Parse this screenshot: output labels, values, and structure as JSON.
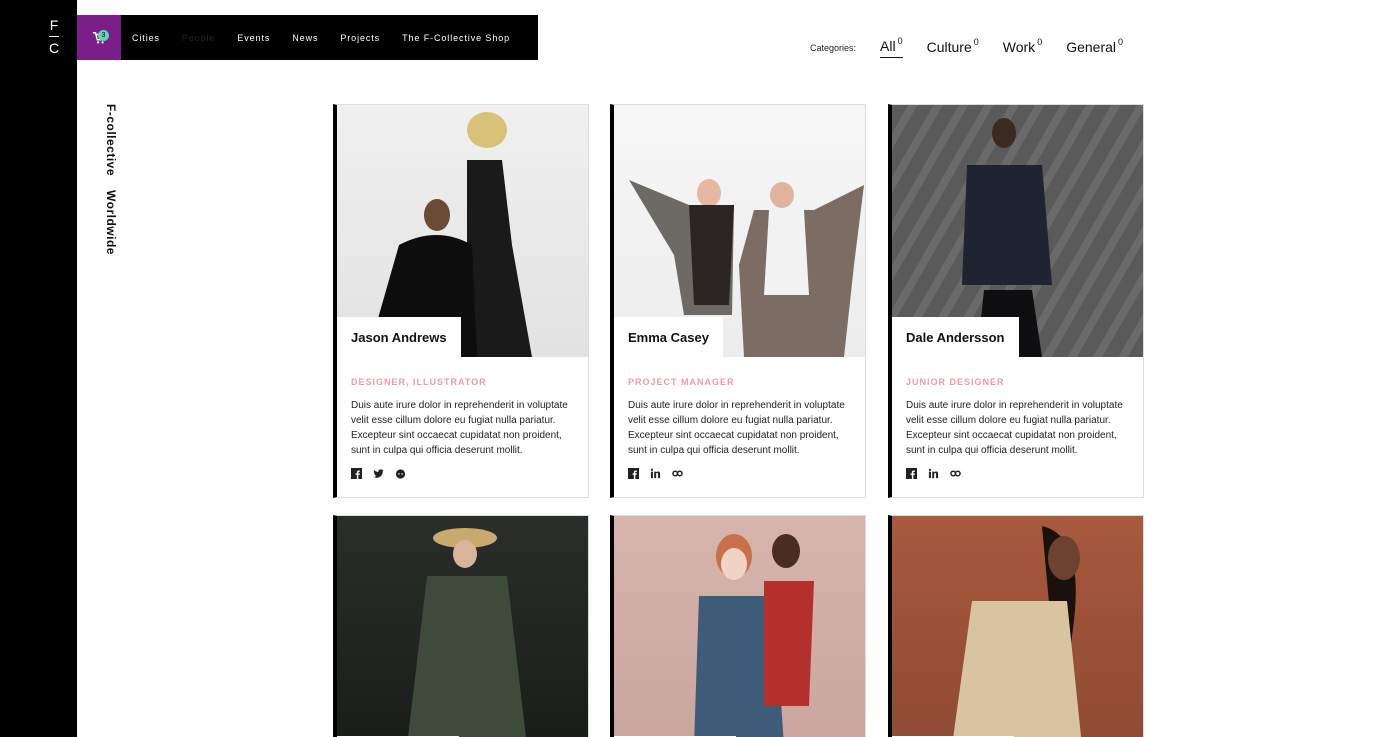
{
  "logo": {
    "line1": "F",
    "line2": "C"
  },
  "site_title": {
    "part1": "F-collective",
    "part2": "Worldwide"
  },
  "cart": {
    "count": "3"
  },
  "nav": [
    "Cities",
    "People",
    "Events",
    "News",
    "Projects",
    "The F-Collective Shop"
  ],
  "categories": {
    "label": "Categories:",
    "items": [
      {
        "label": "All",
        "count": "0"
      },
      {
        "label": "Culture",
        "count": "0"
      },
      {
        "label": "Work",
        "count": "0"
      },
      {
        "label": "General",
        "count": "0"
      }
    ]
  },
  "cards": [
    {
      "name": "Jason Andrews",
      "role": "Designer, Illustrator",
      "desc": "Duis aute irure dolor in reprehenderit in voluptate velit esse cillum dolore eu fugiat nulla pariatur. Excepteur sint occaecat cupidatat non proident, sunt in culpa qui officia deserunt mollit.",
      "socials": [
        "facebook-icon",
        "twitter-icon",
        "github-icon"
      ]
    },
    {
      "name": "Emma Casey",
      "role": "Project Manager",
      "desc": "Duis aute irure dolor in reprehenderit in voluptate velit esse cillum dolore eu fugiat nulla pariatur. Excepteur sint occaecat cupidatat non proident, sunt in culpa qui officia deserunt mollit.",
      "socials": [
        "facebook-icon",
        "linkedin-icon",
        "link-icon"
      ]
    },
    {
      "name": "Dale Andersson",
      "role": "Junior Designer",
      "desc": "Duis aute irure dolor in reprehenderit in voluptate velit esse cillum dolore eu fugiat nulla pariatur. Excepteur sint occaecat cupidatat non proident, sunt in culpa qui officia deserunt mollit.",
      "socials": [
        "facebook-icon",
        "linkedin-icon",
        "link-icon"
      ]
    }
  ],
  "colors": {
    "accent": "#7a1f8a",
    "badge": "#5fd6b6",
    "role": "#f09aa9"
  }
}
